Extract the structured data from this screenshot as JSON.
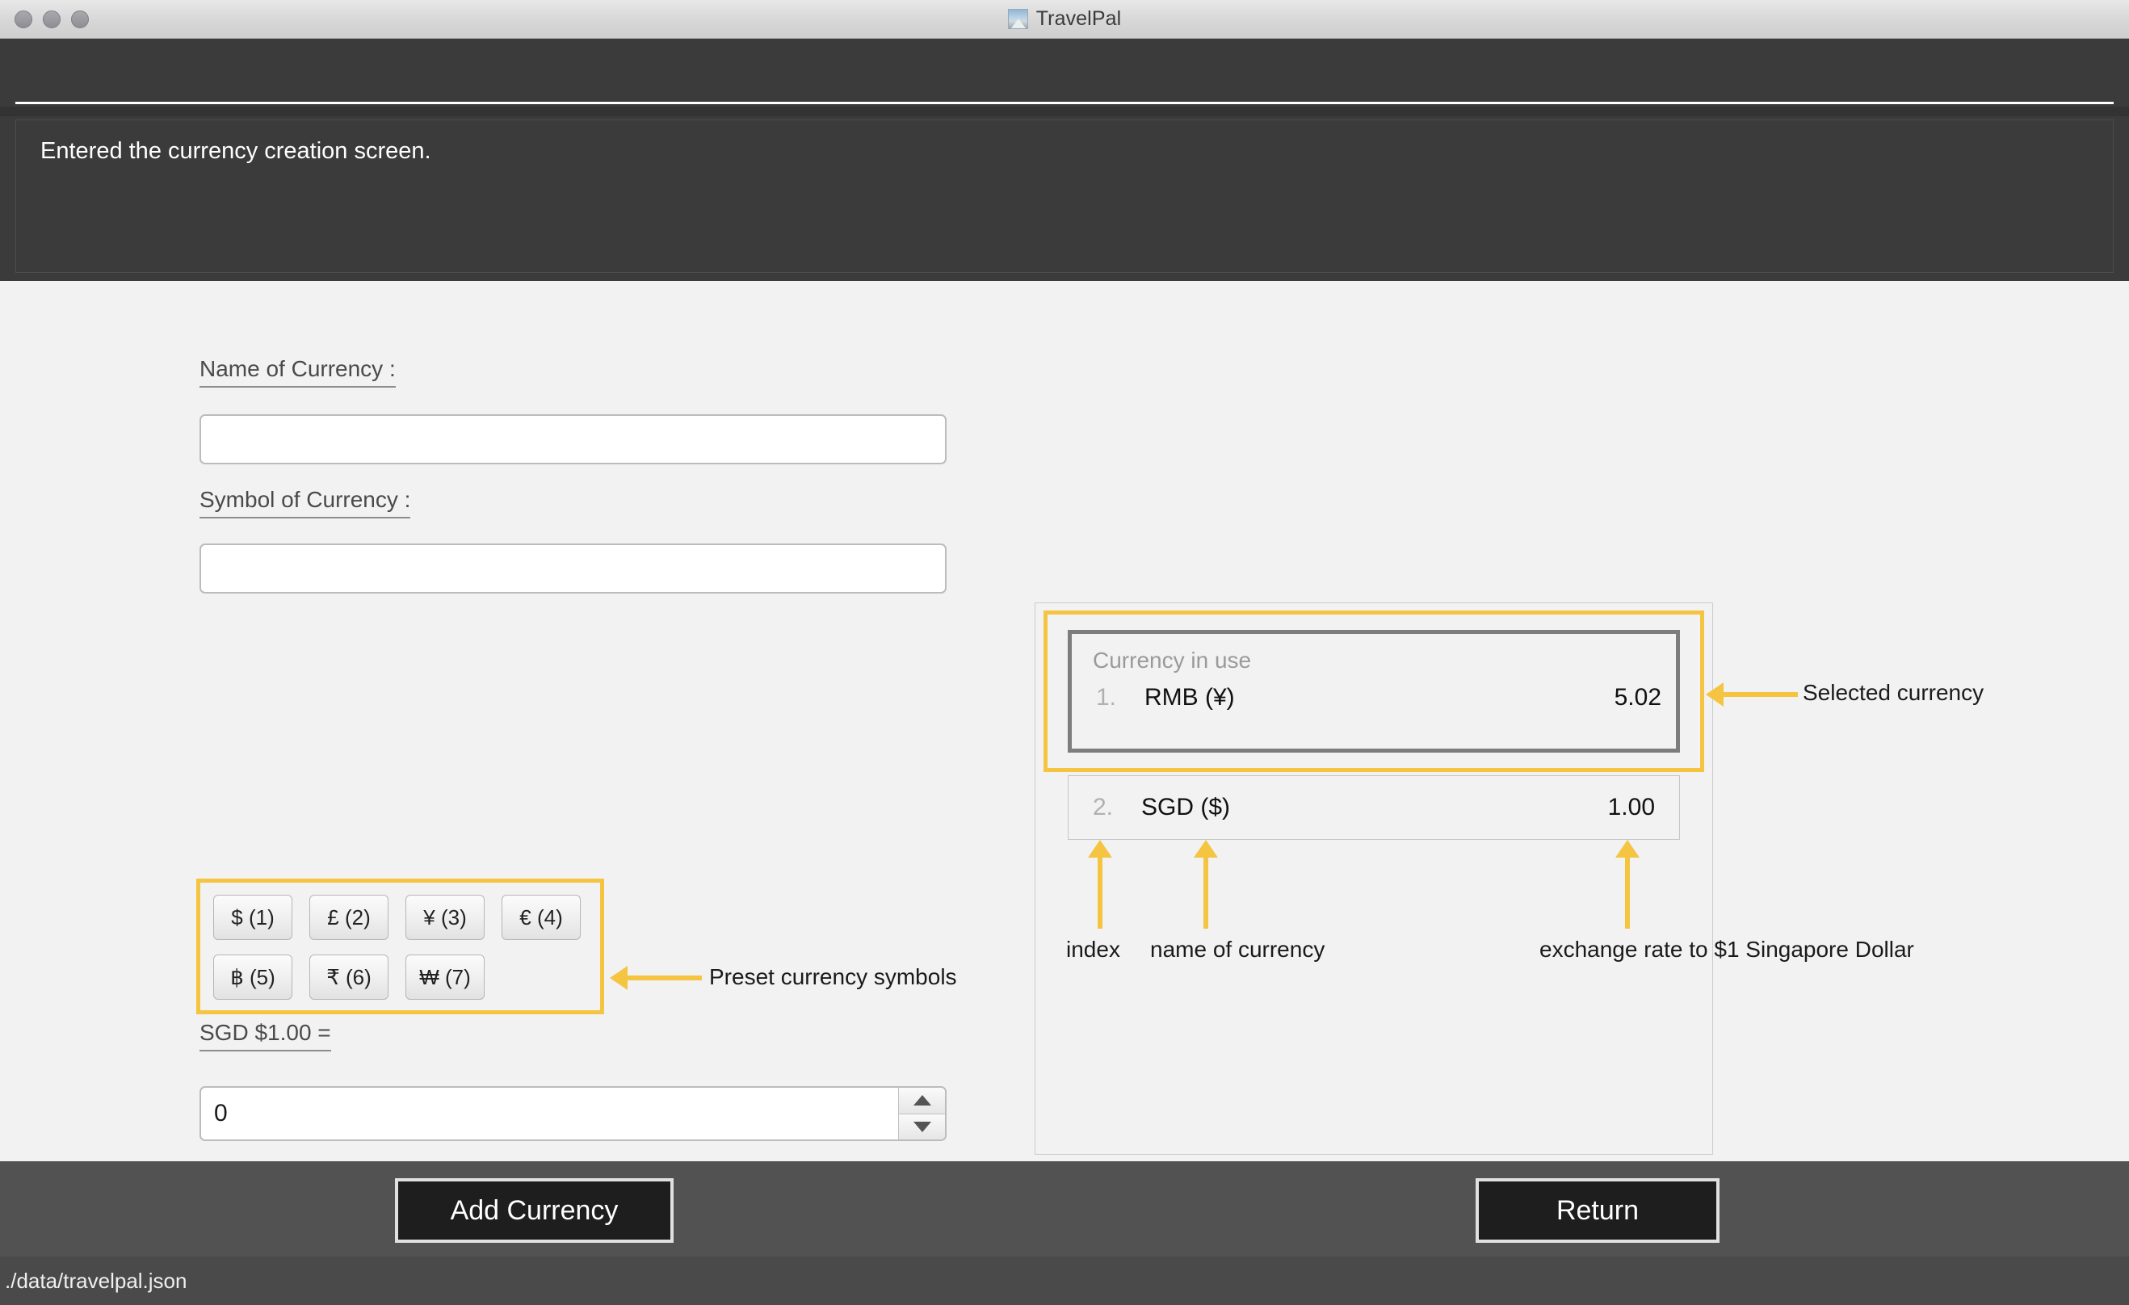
{
  "window": {
    "title": "TravelPal",
    "icon": "mountain-photo-icon",
    "controls": [
      "close",
      "minimize",
      "zoom"
    ]
  },
  "header": {
    "message": "Entered the currency creation screen."
  },
  "form": {
    "name_label": "Name of Currency :",
    "name_value": "",
    "name_placeholder": "",
    "symbol_label": "Symbol of Currency :",
    "symbol_value": "",
    "symbol_placeholder": "",
    "rate_label": "SGD $1.00 =",
    "rate_value": "0",
    "preset_symbols": [
      {
        "label": "$ (1)",
        "symbol": "$",
        "key": "1"
      },
      {
        "label": "£ (2)",
        "symbol": "£",
        "key": "2"
      },
      {
        "label": "¥ (3)",
        "symbol": "¥",
        "key": "3"
      },
      {
        "label": "€ (4)",
        "symbol": "€",
        "key": "4"
      },
      {
        "label": "฿ (5)",
        "symbol": "฿",
        "key": "5"
      },
      {
        "label": "₹ (6)",
        "symbol": "₹",
        "key": "6"
      },
      {
        "label": "₩ (7)",
        "symbol": "₩",
        "key": "7"
      }
    ]
  },
  "currency_list": {
    "header": "Currency in use",
    "items": [
      {
        "index": "1.",
        "name": "RMB (¥)",
        "rate": "5.02",
        "selected": true
      },
      {
        "index": "2.",
        "name": "SGD ($)",
        "rate": "1.00",
        "selected": false
      }
    ]
  },
  "annotations": {
    "selected_currency": "Selected currency",
    "preset_symbols": "Preset currency symbols",
    "index": "index",
    "name_of_currency": "name of currency",
    "exchange_rate": "exchange rate to $1 Singapore Dollar",
    "color": "#f5c441"
  },
  "actions": {
    "add_currency": "Add Currency",
    "return": "Return"
  },
  "status": {
    "path": "./data/travelpal.json"
  }
}
